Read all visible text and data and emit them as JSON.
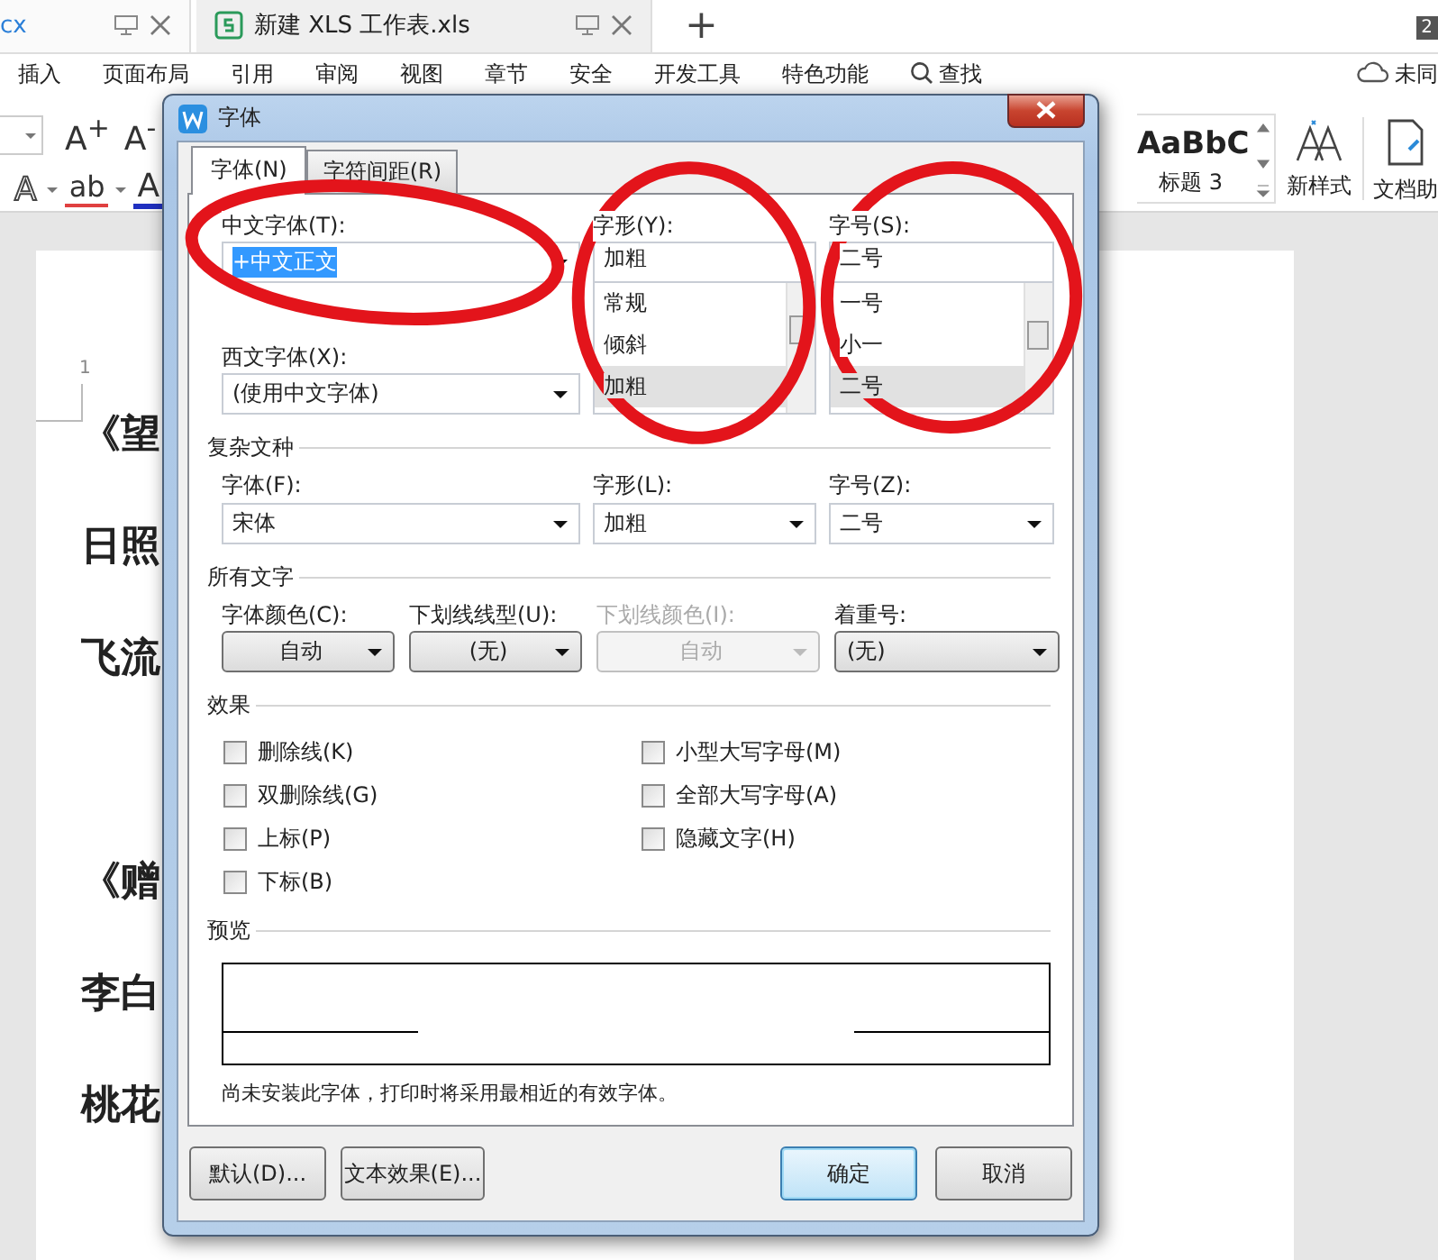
{
  "app_tabs": [
    {
      "label": "cx",
      "selected": true
    },
    {
      "label": "新建 XLS 工作表.xls",
      "selected": false
    }
  ],
  "new_tab": "+",
  "badge": "2",
  "menu": [
    "插入",
    "页面布局",
    "引用",
    "审阅",
    "视图",
    "章节",
    "安全",
    "开发工具",
    "特色功能",
    "查找"
  ],
  "sync_status": "未同",
  "ribbon": {
    "grow_font": "A$^{+}$",
    "shrink_font": "A$^{-}$",
    "text_effect": "A",
    "highlight": "ab",
    "font_color": "A",
    "style_preview": "AaBbC",
    "style_name": "标题 3",
    "new_style": "新样式",
    "assistant": "文档助"
  },
  "document": {
    "page_number": "1",
    "stanzas": [
      [
        "《望",
        "日照",
        "飞流"
      ],
      [
        "《赠",
        "李白",
        "桃花"
      ]
    ]
  },
  "dialog": {
    "title": "字体",
    "tabs": [
      {
        "label": "字体(N)",
        "selected": true
      },
      {
        "label": "字符间距(R)",
        "selected": false
      }
    ],
    "chinese_font": {
      "label": "中文字体(T):",
      "value": "+中文正文",
      "text_selected": true
    },
    "style": {
      "label": "字形(Y):",
      "value": "加粗",
      "options": [
        {
          "label": "常规",
          "selected": false
        },
        {
          "label": "倾斜",
          "selected": false
        },
        {
          "label": "加粗",
          "selected": true
        }
      ]
    },
    "size": {
      "label": "字号(S):",
      "value": "二号",
      "options": [
        {
          "label": "一号",
          "selected": false
        },
        {
          "label": "小一",
          "selected": false
        },
        {
          "label": "二号",
          "selected": true
        }
      ]
    },
    "western_font": {
      "label": "西文字体(X):",
      "value": "(使用中文字体)"
    },
    "complex_section": "复杂文种",
    "complex_fields": [
      {
        "label": "字体(F):",
        "value": "宋体"
      },
      {
        "label": "字形(L):",
        "value": "加粗"
      },
      {
        "label": "字号(Z):",
        "value": "二号"
      }
    ],
    "all_text_section": "所有文字",
    "all_text_fields": [
      {
        "label": "字体颜色(C):",
        "value": "自动",
        "kind": "button",
        "disabled": false
      },
      {
        "label": "下划线线型(U):",
        "value": "(无)",
        "kind": "button",
        "disabled": false
      },
      {
        "label": "下划线颜色(I):",
        "value": "自动",
        "kind": "button",
        "disabled": true
      },
      {
        "label": "着重号:",
        "value": "(无)",
        "kind": "combo",
        "disabled": false
      }
    ],
    "effects_section": "效果",
    "effects_left": [
      {
        "label": "删除线(K)",
        "checked": false
      },
      {
        "label": "双删除线(G)",
        "checked": false
      },
      {
        "label": "上标(P)",
        "checked": false
      },
      {
        "label": "下标(B)",
        "checked": false
      }
    ],
    "effects_right": [
      {
        "label": "小型大写字母(M)",
        "checked": false
      },
      {
        "label": "全部大写字母(A)",
        "checked": false
      },
      {
        "label": "隐藏文字(H)",
        "checked": false
      }
    ],
    "preview_section": "预览",
    "note": "尚未安装此字体，打印时将采用最相近的有效字体。",
    "left_buttons": [
      "默认(D)...",
      "文本效果(E)..."
    ],
    "right_buttons": [
      {
        "label": "确定",
        "default": true
      },
      {
        "label": "取消",
        "default": false
      }
    ]
  }
}
